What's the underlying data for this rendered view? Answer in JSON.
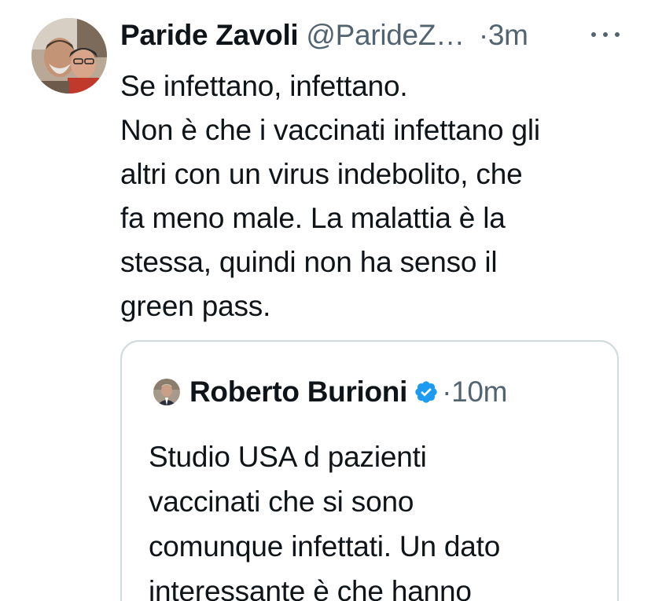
{
  "tweet": {
    "author": {
      "display_name": "Paride Zavoli",
      "handle": "@ParideZ…"
    },
    "separator": "·",
    "time": "3m",
    "more_icon": "more-horizontal-icon",
    "text_lines": [
      "Se infettano, infettano.",
      "Non è che i vaccinati infettano gli",
      "altri con un virus indebolito, che",
      "fa meno male. La malattia è la",
      "stessa, quindi non ha senso il",
      "green pass."
    ]
  },
  "quoted_tweet": {
    "author": {
      "display_name": "Roberto Burioni",
      "verified_icon": "verified-badge-icon"
    },
    "separator": "·",
    "time": "10m",
    "text_lines": [
      "Studio USA d pazienti",
      "vaccinati che si sono",
      "comunque infettati. Un dato",
      "interessante è che hanno"
    ]
  },
  "colors": {
    "text_primary": "#0f1419",
    "text_secondary": "#536471",
    "verified_blue": "#1d9bf0",
    "card_border": "#cfd9de"
  }
}
